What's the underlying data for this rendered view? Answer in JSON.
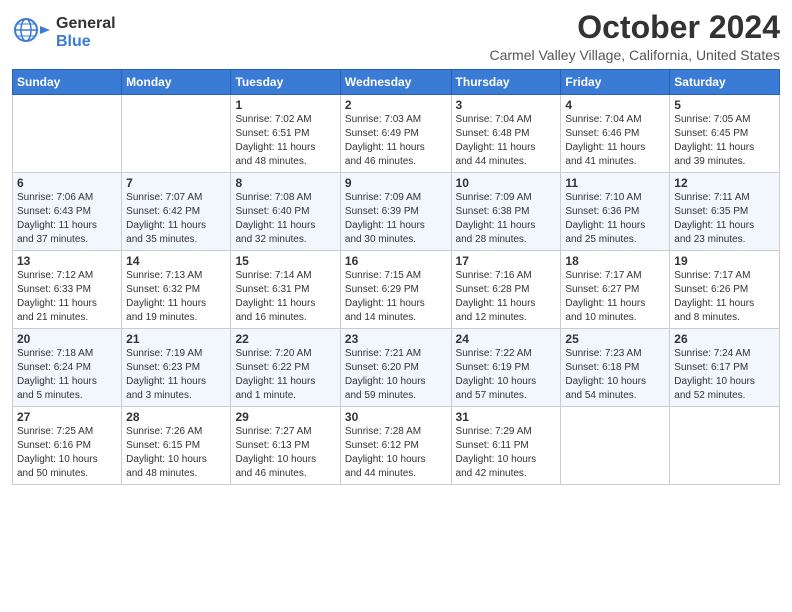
{
  "header": {
    "logo_general": "General",
    "logo_blue": "Blue",
    "month_title": "October 2024",
    "location": "Carmel Valley Village, California, United States"
  },
  "columns": [
    "Sunday",
    "Monday",
    "Tuesday",
    "Wednesday",
    "Thursday",
    "Friday",
    "Saturday"
  ],
  "weeks": [
    [
      {
        "day": "",
        "info": ""
      },
      {
        "day": "",
        "info": ""
      },
      {
        "day": "1",
        "info": "Sunrise: 7:02 AM\nSunset: 6:51 PM\nDaylight: 11 hours\nand 48 minutes."
      },
      {
        "day": "2",
        "info": "Sunrise: 7:03 AM\nSunset: 6:49 PM\nDaylight: 11 hours\nand 46 minutes."
      },
      {
        "day": "3",
        "info": "Sunrise: 7:04 AM\nSunset: 6:48 PM\nDaylight: 11 hours\nand 44 minutes."
      },
      {
        "day": "4",
        "info": "Sunrise: 7:04 AM\nSunset: 6:46 PM\nDaylight: 11 hours\nand 41 minutes."
      },
      {
        "day": "5",
        "info": "Sunrise: 7:05 AM\nSunset: 6:45 PM\nDaylight: 11 hours\nand 39 minutes."
      }
    ],
    [
      {
        "day": "6",
        "info": "Sunrise: 7:06 AM\nSunset: 6:43 PM\nDaylight: 11 hours\nand 37 minutes."
      },
      {
        "day": "7",
        "info": "Sunrise: 7:07 AM\nSunset: 6:42 PM\nDaylight: 11 hours\nand 35 minutes."
      },
      {
        "day": "8",
        "info": "Sunrise: 7:08 AM\nSunset: 6:40 PM\nDaylight: 11 hours\nand 32 minutes."
      },
      {
        "day": "9",
        "info": "Sunrise: 7:09 AM\nSunset: 6:39 PM\nDaylight: 11 hours\nand 30 minutes."
      },
      {
        "day": "10",
        "info": "Sunrise: 7:09 AM\nSunset: 6:38 PM\nDaylight: 11 hours\nand 28 minutes."
      },
      {
        "day": "11",
        "info": "Sunrise: 7:10 AM\nSunset: 6:36 PM\nDaylight: 11 hours\nand 25 minutes."
      },
      {
        "day": "12",
        "info": "Sunrise: 7:11 AM\nSunset: 6:35 PM\nDaylight: 11 hours\nand 23 minutes."
      }
    ],
    [
      {
        "day": "13",
        "info": "Sunrise: 7:12 AM\nSunset: 6:33 PM\nDaylight: 11 hours\nand 21 minutes."
      },
      {
        "day": "14",
        "info": "Sunrise: 7:13 AM\nSunset: 6:32 PM\nDaylight: 11 hours\nand 19 minutes."
      },
      {
        "day": "15",
        "info": "Sunrise: 7:14 AM\nSunset: 6:31 PM\nDaylight: 11 hours\nand 16 minutes."
      },
      {
        "day": "16",
        "info": "Sunrise: 7:15 AM\nSunset: 6:29 PM\nDaylight: 11 hours\nand 14 minutes."
      },
      {
        "day": "17",
        "info": "Sunrise: 7:16 AM\nSunset: 6:28 PM\nDaylight: 11 hours\nand 12 minutes."
      },
      {
        "day": "18",
        "info": "Sunrise: 7:17 AM\nSunset: 6:27 PM\nDaylight: 11 hours\nand 10 minutes."
      },
      {
        "day": "19",
        "info": "Sunrise: 7:17 AM\nSunset: 6:26 PM\nDaylight: 11 hours\nand 8 minutes."
      }
    ],
    [
      {
        "day": "20",
        "info": "Sunrise: 7:18 AM\nSunset: 6:24 PM\nDaylight: 11 hours\nand 5 minutes."
      },
      {
        "day": "21",
        "info": "Sunrise: 7:19 AM\nSunset: 6:23 PM\nDaylight: 11 hours\nand 3 minutes."
      },
      {
        "day": "22",
        "info": "Sunrise: 7:20 AM\nSunset: 6:22 PM\nDaylight: 11 hours\nand 1 minute."
      },
      {
        "day": "23",
        "info": "Sunrise: 7:21 AM\nSunset: 6:20 PM\nDaylight: 10 hours\nand 59 minutes."
      },
      {
        "day": "24",
        "info": "Sunrise: 7:22 AM\nSunset: 6:19 PM\nDaylight: 10 hours\nand 57 minutes."
      },
      {
        "day": "25",
        "info": "Sunrise: 7:23 AM\nSunset: 6:18 PM\nDaylight: 10 hours\nand 54 minutes."
      },
      {
        "day": "26",
        "info": "Sunrise: 7:24 AM\nSunset: 6:17 PM\nDaylight: 10 hours\nand 52 minutes."
      }
    ],
    [
      {
        "day": "27",
        "info": "Sunrise: 7:25 AM\nSunset: 6:16 PM\nDaylight: 10 hours\nand 50 minutes."
      },
      {
        "day": "28",
        "info": "Sunrise: 7:26 AM\nSunset: 6:15 PM\nDaylight: 10 hours\nand 48 minutes."
      },
      {
        "day": "29",
        "info": "Sunrise: 7:27 AM\nSunset: 6:13 PM\nDaylight: 10 hours\nand 46 minutes."
      },
      {
        "day": "30",
        "info": "Sunrise: 7:28 AM\nSunset: 6:12 PM\nDaylight: 10 hours\nand 44 minutes."
      },
      {
        "day": "31",
        "info": "Sunrise: 7:29 AM\nSunset: 6:11 PM\nDaylight: 10 hours\nand 42 minutes."
      },
      {
        "day": "",
        "info": ""
      },
      {
        "day": "",
        "info": ""
      }
    ]
  ]
}
